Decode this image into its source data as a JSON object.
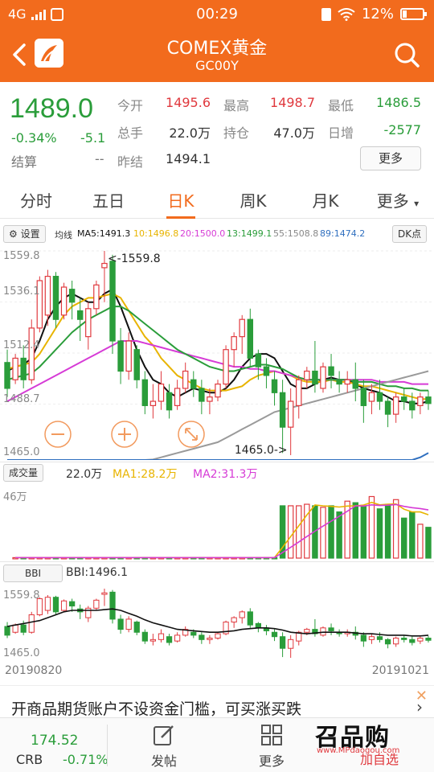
{
  "status": {
    "network": "4G",
    "time": "00:29",
    "battery": "12%"
  },
  "header": {
    "title": "COMEX黄金",
    "subtitle": "GC00Y"
  },
  "quote": {
    "price": "1489.0",
    "change_pct": "-0.34%",
    "change": "-5.1",
    "settle_label": "结算",
    "settle_value": "--",
    "open_label": "今开",
    "open_value": "1495.6",
    "high_label": "最高",
    "high_value": "1498.7",
    "low_label": "最低",
    "low_value": "1486.5",
    "volume_label": "总手",
    "volume_value": "22.0万",
    "oi_label": "持仓",
    "oi_value": "47.0万",
    "daily_inc_label": "日增",
    "daily_inc_value": "-2577",
    "prev_label": "昨结",
    "prev_value": "1494.1",
    "more_button": "更多"
  },
  "tabs": [
    "分时",
    "五日",
    "日K",
    "周K",
    "月K",
    "更多"
  ],
  "active_tab": 2,
  "indicator_bar": {
    "settings_button": "设置",
    "ma_label": "均线",
    "ma5": "MA5:1491.3",
    "ma10": "10:1496.8",
    "ma20": "20:1500.0",
    "ma13": "13:1499.1",
    "ma55": "55:1508.8",
    "ma89": "89:1474.2",
    "dk_button": "DK点"
  },
  "kline": {
    "y_labels": [
      "1559.8",
      "1536.1",
      "1512.4",
      "1488.7",
      "1465.0"
    ],
    "max_marker": "<-1559.8",
    "min_marker": "1465.0->"
  },
  "volume": {
    "button": "成交量",
    "value": "22.0万",
    "ma1": "MA1:28.2万",
    "ma2": "MA2:31.3万",
    "y_label": "46万"
  },
  "bbi": {
    "button": "BBI",
    "value": "BBI:1496.1",
    "y_top": "1559.8",
    "y_bottom": "1465.0"
  },
  "dates": {
    "start": "20190820",
    "end": "20191021"
  },
  "ad": {
    "text": "开商品期货账户不设资金门槛，可买涨买跌"
  },
  "bottom": {
    "index_value": "174.52",
    "index_name": "CRB",
    "index_change": "-0.71%",
    "post_label": "发帖",
    "more_label": "更多",
    "watchlist_label": "加自选",
    "watermark": "召品购",
    "watermark_url": "www.MPdaogou.com"
  },
  "colors": {
    "brand": "#f26b1d",
    "up": "#e0393e",
    "down": "#2a9d3a",
    "ma5": "#111111",
    "ma10": "#e8b400",
    "ma20": "#d63bd6",
    "ma13": "#2a9d3a",
    "ma55": "#9a9a9a",
    "ma89": "#2f6fbf"
  },
  "chart_data": {
    "type": "candlestick",
    "x_range": [
      "20190820",
      "20191021"
    ],
    "ylim": [
      1465.0,
      1559.8
    ],
    "candles": [
      {
        "o": 1508,
        "h": 1514,
        "c": 1496,
        "l": 1492
      },
      {
        "o": 1500,
        "h": 1512,
        "c": 1510,
        "l": 1498
      },
      {
        "o": 1510,
        "h": 1516,
        "c": 1500,
        "l": 1496
      },
      {
        "o": 1500,
        "h": 1528,
        "c": 1524,
        "l": 1498
      },
      {
        "o": 1524,
        "h": 1548,
        "c": 1546,
        "l": 1522
      },
      {
        "o": 1530,
        "h": 1551,
        "c": 1548,
        "l": 1525
      },
      {
        "o": 1548,
        "h": 1550,
        "c": 1528,
        "l": 1524
      },
      {
        "o": 1530,
        "h": 1545,
        "c": 1543,
        "l": 1528
      },
      {
        "o": 1542,
        "h": 1546,
        "c": 1536,
        "l": 1528
      },
      {
        "o": 1532,
        "h": 1538,
        "c": 1528,
        "l": 1518
      },
      {
        "o": 1520,
        "h": 1536,
        "c": 1533,
        "l": 1514
      },
      {
        "o": 1533,
        "h": 1546,
        "c": 1544,
        "l": 1530
      },
      {
        "o": 1552,
        "h": 1559.8,
        "c": 1554,
        "l": 1536
      },
      {
        "o": 1555,
        "h": 1558,
        "c": 1518,
        "l": 1512
      },
      {
        "o": 1518,
        "h": 1524,
        "c": 1504,
        "l": 1498
      },
      {
        "o": 1504,
        "h": 1522,
        "c": 1518,
        "l": 1500
      },
      {
        "o": 1514,
        "h": 1516,
        "c": 1500,
        "l": 1496
      },
      {
        "o": 1500,
        "h": 1504,
        "c": 1488,
        "l": 1484
      },
      {
        "o": 1488,
        "h": 1498,
        "c": 1490,
        "l": 1482
      },
      {
        "o": 1490,
        "h": 1504,
        "c": 1498,
        "l": 1486
      },
      {
        "o": 1494,
        "h": 1498,
        "c": 1486,
        "l": 1482
      },
      {
        "o": 1488,
        "h": 1500,
        "c": 1496,
        "l": 1486
      },
      {
        "o": 1496,
        "h": 1508,
        "c": 1504,
        "l": 1494
      },
      {
        "o": 1500,
        "h": 1504,
        "c": 1496,
        "l": 1492
      },
      {
        "o": 1496,
        "h": 1500,
        "c": 1490,
        "l": 1484
      },
      {
        "o": 1490,
        "h": 1496,
        "c": 1492,
        "l": 1484
      },
      {
        "o": 1492,
        "h": 1500,
        "c": 1498,
        "l": 1490
      },
      {
        "o": 1498,
        "h": 1516,
        "c": 1514,
        "l": 1496
      },
      {
        "o": 1514,
        "h": 1522,
        "c": 1520,
        "l": 1506
      },
      {
        "o": 1520,
        "h": 1530,
        "c": 1528,
        "l": 1512
      },
      {
        "o": 1528,
        "h": 1533,
        "c": 1510,
        "l": 1506
      },
      {
        "o": 1512,
        "h": 1514,
        "c": 1506,
        "l": 1500
      },
      {
        "o": 1506,
        "h": 1510,
        "c": 1502,
        "l": 1496
      },
      {
        "o": 1500,
        "h": 1504,
        "c": 1494,
        "l": 1488
      },
      {
        "o": 1494,
        "h": 1500,
        "c": 1478,
        "l": 1466
      },
      {
        "o": 1478,
        "h": 1496,
        "c": 1490,
        "l": 1465.0
      },
      {
        "o": 1488,
        "h": 1502,
        "c": 1500,
        "l": 1482
      },
      {
        "o": 1500,
        "h": 1506,
        "c": 1504,
        "l": 1496
      },
      {
        "o": 1504,
        "h": 1518,
        "c": 1498,
        "l": 1494
      },
      {
        "o": 1496,
        "h": 1508,
        "c": 1506,
        "l": 1494
      },
      {
        "o": 1506,
        "h": 1512,
        "c": 1502,
        "l": 1496
      },
      {
        "o": 1500,
        "h": 1504,
        "c": 1498,
        "l": 1494
      },
      {
        "o": 1498,
        "h": 1504,
        "c": 1500,
        "l": 1494
      },
      {
        "o": 1500,
        "h": 1508,
        "c": 1496,
        "l": 1490
      },
      {
        "o": 1496,
        "h": 1500,
        "c": 1488,
        "l": 1480
      },
      {
        "o": 1490,
        "h": 1498,
        "c": 1494,
        "l": 1484
      },
      {
        "o": 1494,
        "h": 1500,
        "c": 1490,
        "l": 1486
      },
      {
        "o": 1490,
        "h": 1492,
        "c": 1484,
        "l": 1478
      },
      {
        "o": 1484,
        "h": 1494,
        "c": 1492,
        "l": 1480
      },
      {
        "o": 1492,
        "h": 1496,
        "c": 1490,
        "l": 1486
      },
      {
        "o": 1490,
        "h": 1494,
        "c": 1486,
        "l": 1482
      },
      {
        "o": 1488,
        "h": 1494,
        "c": 1492,
        "l": 1484
      },
      {
        "o": 1492,
        "h": 1495,
        "c": 1489,
        "l": 1486
      }
    ],
    "volume_ylim": [
      0,
      460000
    ],
    "volumes": [
      3000,
      3000,
      3000,
      3000,
      3000,
      3000,
      3000,
      3000,
      3000,
      3000,
      3000,
      3000,
      3000,
      3000,
      3000,
      3000,
      3000,
      3000,
      3000,
      3000,
      3000,
      3000,
      3000,
      3000,
      3000,
      3000,
      3000,
      3000,
      3000,
      3000,
      3000,
      3000,
      3000,
      340000,
      340000,
      340000,
      350000,
      340000,
      330000,
      340000,
      300000,
      370000,
      360000,
      340000,
      400000,
      320000,
      350000,
      380000,
      260000,
      300000,
      220000,
      200000
    ],
    "series": [
      {
        "name": "MA5",
        "values": [
          1504,
          1506,
          1507,
          1510,
          1518,
          1528,
          1534,
          1538,
          1540,
          1538,
          1536,
          1536,
          1540,
          1542,
          1534,
          1524,
          1514,
          1506,
          1500,
          1498,
          1494,
          1492,
          1494,
          1496,
          1495,
          1494,
          1494,
          1496,
          1500,
          1506,
          1510,
          1512,
          1512,
          1510,
          1504,
          1498,
          1496,
          1496,
          1498,
          1500,
          1501,
          1500,
          1500,
          1498,
          1496,
          1495,
          1494,
          1492,
          1490,
          1490,
          1489,
          1489,
          1490
        ]
      },
      {
        "name": "10",
        "values": [
          1505,
          1506,
          1507,
          1508,
          1512,
          1518,
          1524,
          1530,
          1534,
          1536,
          1538,
          1538,
          1539,
          1540,
          1538,
          1532,
          1526,
          1520,
          1516,
          1510,
          1506,
          1502,
          1500,
          1498,
          1496,
          1495,
          1495,
          1495,
          1496,
          1497,
          1500,
          1502,
          1503,
          1504,
          1503,
          1502,
          1500,
          1499,
          1499,
          1499,
          1500,
          1499,
          1499,
          1498,
          1497,
          1497,
          1496,
          1495,
          1494,
          1493,
          1492,
          1491,
          1491
        ]
      },
      {
        "name": "20",
        "values": [
          1490,
          1492,
          1494,
          1496,
          1498,
          1500,
          1502,
          1504,
          1506,
          1508,
          1510,
          1512,
          1514,
          1516,
          1518,
          1518,
          1518,
          1517,
          1516,
          1515,
          1514,
          1513,
          1512,
          1511,
          1510,
          1509,
          1508,
          1507,
          1506,
          1506,
          1505,
          1505,
          1504,
          1504,
          1503,
          1502,
          1501,
          1500,
          1500,
          1500,
          1500,
          1500,
          1500,
          1500,
          1500,
          1500,
          1499,
          1499,
          1499,
          1499,
          1498,
          1498,
          1498
        ]
      },
      {
        "name": "13",
        "values": [
          1500,
          1501,
          1502,
          1503,
          1506,
          1510,
          1514,
          1518,
          1522,
          1525,
          1528,
          1530,
          1532,
          1534,
          1534,
          1532,
          1529,
          1526,
          1523,
          1520,
          1517,
          1514,
          1512,
          1510,
          1508,
          1506,
          1505,
          1504,
          1504,
          1505,
          1506,
          1507,
          1507,
          1506,
          1505,
          1503,
          1501,
          1500,
          1500,
          1500,
          1500,
          1500,
          1500,
          1499,
          1499,
          1499,
          1498,
          1497,
          1497,
          1496,
          1496,
          1495,
          1495
        ]
      },
      {
        "name": "55",
        "values": [
          1445,
          1446,
          1447,
          1448,
          1449,
          1450,
          1451,
          1452,
          1453,
          1454,
          1455,
          1456,
          1457,
          1458,
          1459,
          1460,
          1461,
          1462,
          1463,
          1464,
          1465,
          1466,
          1467,
          1468,
          1469,
          1470,
          1471,
          1473,
          1475,
          1477,
          1479,
          1481,
          1483,
          1485,
          1486,
          1487,
          1488,
          1489,
          1490,
          1491,
          1492,
          1493,
          1494,
          1495,
          1496,
          1497,
          1498,
          1499,
          1500,
          1501,
          1502,
          1503,
          1504
        ]
      },
      {
        "name": "89",
        "values": [
          1400,
          1401,
          1402,
          1403,
          1404,
          1405,
          1406,
          1407,
          1408,
          1409,
          1410,
          1411,
          1412,
          1413,
          1414,
          1415,
          1416,
          1417,
          1418,
          1419,
          1420,
          1421,
          1422,
          1423,
          1424,
          1425,
          1426,
          1427,
          1428,
          1429,
          1430,
          1431,
          1432,
          1433,
          1434,
          1435,
          1436,
          1437,
          1438,
          1440,
          1442,
          1444,
          1446,
          1448,
          1450,
          1452,
          1454,
          1456,
          1458,
          1460,
          1462,
          1464,
          1466
        ]
      }
    ],
    "volume_series": [
      {
        "name": "MA1",
        "values": [
          3000,
          3000,
          3000,
          3000,
          3000,
          3000,
          3000,
          3000,
          3000,
          3000,
          3000,
          3000,
          3000,
          3000,
          3000,
          3000,
          3000,
          3000,
          3000,
          3000,
          3000,
          3000,
          3000,
          3000,
          3000,
          3000,
          3000,
          3000,
          3000,
          3000,
          3000,
          3000,
          3000,
          70000,
          140000,
          210000,
          280000,
          345000,
          340000,
          336000,
          332000,
          338000,
          340000,
          345000,
          362000,
          346000,
          350000,
          352000,
          318000,
          300000,
          300000,
          282000
        ]
      },
      {
        "name": "MA2",
        "values": [
          3000,
          3000,
          3000,
          3000,
          3000,
          3000,
          3000,
          3000,
          3000,
          3000,
          3000,
          3000,
          3000,
          3000,
          3000,
          3000,
          3000,
          3000,
          3000,
          3000,
          3000,
          3000,
          3000,
          3000,
          3000,
          3000,
          3000,
          3000,
          3000,
          3000,
          3000,
          3000,
          3000,
          36000,
          70000,
          105000,
          140000,
          175000,
          208000,
          240000,
          272000,
          305000,
          340000,
          338000,
          346000,
          342000,
          344000,
          348000,
          336000,
          328000,
          322000,
          313000
        ]
      }
    ],
    "bbi_series": {
      "name": "BBI",
      "values": [
        1508,
        1510,
        1512,
        1514,
        1516,
        1520,
        1524,
        1528,
        1530,
        1530,
        1530,
        1530,
        1531,
        1532,
        1530,
        1526,
        1522,
        1517,
        1513,
        1510,
        1507,
        1504,
        1503,
        1502,
        1501,
        1500,
        1500,
        1501,
        1502,
        1504,
        1505,
        1506,
        1506,
        1505,
        1503,
        1500,
        1499,
        1498,
        1499,
        1500,
        1500,
        1500,
        1500,
        1499,
        1498,
        1498,
        1497,
        1496,
        1496,
        1496,
        1495,
        1495,
        1496
      ]
    }
  }
}
